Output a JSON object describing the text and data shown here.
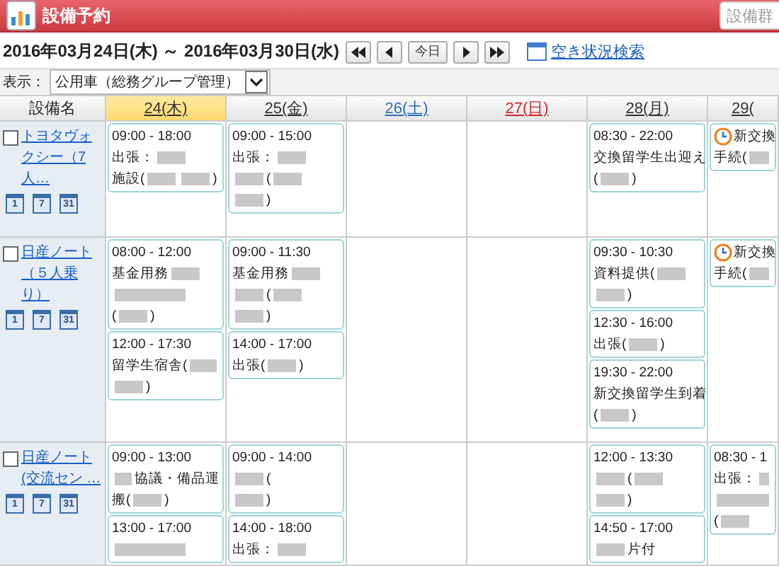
{
  "app": {
    "title": "設備予約",
    "top_button": "設備群"
  },
  "range": "2016年03月24日(木) ～ 2016年03月30日(水)",
  "nav": [
    {
      "kind": "first"
    },
    {
      "kind": "prev"
    },
    {
      "kind": "today",
      "label": "今日"
    },
    {
      "kind": "next"
    },
    {
      "kind": "last"
    }
  ],
  "search_link": "空き状況検索",
  "display": {
    "label": "表示：",
    "value": "公用車（総務グループ管理）"
  },
  "table": {
    "name_header": "設備名",
    "days": [
      {
        "label": "24(木)",
        "kind": "weekday",
        "selected": true
      },
      {
        "label": "25(金)",
        "kind": "weekday",
        "selected": false
      },
      {
        "label": "26(土)",
        "kind": "saturday",
        "selected": false
      },
      {
        "label": "27(日)",
        "kind": "sunday",
        "selected": false
      },
      {
        "label": "28(月)",
        "kind": "weekday",
        "selected": false
      },
      {
        "label": "29(",
        "kind": "weekday",
        "selected": false
      }
    ],
    "rows": [
      {
        "name": "トヨタヴォクシー（7人…",
        "checked": false,
        "views": [
          "1",
          "7",
          "31"
        ],
        "cells": [
          [
            {
              "time": "09:00 - 18:00",
              "lines": [
                [
                  "出張：",
                  {
                    "kind": "blur"
                  }
                ],
                [
                  "施設(",
                  {
                    "kind": "blur"
                  },
                  {
                    "kind": "blur"
                  },
                  ")"
                ]
              ]
            }
          ],
          [
            {
              "time": "09:00 - 15:00",
              "lines": [
                [
                  "出張：",
                  {
                    "kind": "blur"
                  }
                ],
                [
                  {
                    "kind": "blur"
                  },
                  "(",
                  {
                    "kind": "blur"
                  }
                ],
                [
                  {
                    "kind": "blur"
                  },
                  ")"
                ]
              ]
            }
          ],
          [],
          [],
          [
            {
              "time": "08:30 - 22:00",
              "lines": [
                [
                  "交換留学生出迎え"
                ],
                [
                  "(",
                  {
                    "kind": "blur"
                  },
                  ")"
                ]
              ]
            }
          ],
          [
            {
              "kind": "reminder",
              "lines": [
                [
                  "新交換"
                ],
                [
                  "手続(",
                  {
                    "kind": "blur"
                  }
                ]
              ]
            }
          ]
        ]
      },
      {
        "name": "日産ノート（５人乗り）",
        "checked": false,
        "views": [
          "1",
          "7",
          "31"
        ],
        "cells": [
          [
            {
              "time": "08:00 - 12:00",
              "lines": [
                [
                  "基金用務",
                  {
                    "kind": "blur"
                  }
                ],
                [
                  {
                    "kind": "blur"
                  }
                ],
                [
                  "(",
                  {
                    "kind": "blur"
                  },
                  ")"
                ]
              ]
            },
            {
              "time": "12:00 - 17:30",
              "lines": [
                [
                  "留学生宿舎(",
                  {
                    "kind": "blur"
                  }
                ],
                [
                  {
                    "kind": "blur"
                  },
                  ")"
                ]
              ]
            }
          ],
          [
            {
              "time": "09:00 - 11:30",
              "lines": [
                [
                  "基金用務",
                  {
                    "kind": "blur"
                  }
                ],
                [
                  {
                    "kind": "blur"
                  },
                  "(",
                  {
                    "kind": "blur"
                  }
                ],
                [
                  {
                    "kind": "blur"
                  },
                  ")"
                ]
              ]
            },
            {
              "time": "14:00 - 17:00",
              "lines": [
                [
                  "出張(",
                  {
                    "kind": "blur"
                  },
                  ")"
                ]
              ]
            }
          ],
          [],
          [],
          [
            {
              "time": "09:30 - 10:30",
              "lines": [
                [
                  "資料提供(",
                  {
                    "kind": "blur"
                  }
                ],
                [
                  {
                    "kind": "blur"
                  },
                  ")"
                ]
              ]
            },
            {
              "time": "12:30 - 16:00",
              "lines": [
                [
                  "出張(",
                  {
                    "kind": "blur"
                  },
                  ")"
                ]
              ]
            },
            {
              "time": "19:30 - 22:00",
              "lines": [
                [
                  "新交換留学生到着"
                ],
                [
                  "(",
                  {
                    "kind": "blur"
                  },
                  ")"
                ]
              ]
            }
          ],
          [
            {
              "kind": "reminder",
              "lines": [
                [
                  "新交換"
                ],
                [
                  "手続(",
                  {
                    "kind": "blur"
                  }
                ]
              ]
            }
          ]
        ]
      },
      {
        "name": "日産ノート(交流セン …",
        "checked": false,
        "views": [
          "1",
          "7",
          "31"
        ],
        "cells": [
          [
            {
              "time": "09:00 - 13:00",
              "lines": [
                [
                  {
                    "kind": "blur"
                  },
                  "協議・備品運"
                ],
                [
                  "搬(",
                  {
                    "kind": "blur"
                  },
                  ")"
                ]
              ]
            },
            {
              "time": "13:00 - 17:00",
              "lines": [
                [
                  {
                    "kind": "blur"
                  }
                ]
              ]
            }
          ],
          [
            {
              "time": "09:00 - 14:00",
              "lines": [
                [
                  {
                    "kind": "blur"
                  },
                  "("
                ],
                [
                  {
                    "kind": "blur"
                  },
                  ")"
                ]
              ]
            },
            {
              "time": "14:00 - 18:00",
              "lines": [
                [
                  "出張：",
                  {
                    "kind": "blur"
                  }
                ]
              ]
            }
          ],
          [],
          [],
          [
            {
              "time": "12:00 - 13:30",
              "lines": [
                [
                  {
                    "kind": "blur"
                  },
                  "(",
                  {
                    "kind": "blur"
                  }
                ],
                [
                  {
                    "kind": "blur"
                  },
                  ")"
                ]
              ]
            },
            {
              "time": "14:50 - 17:00",
              "lines": [
                [
                  {
                    "kind": "blur"
                  },
                  "片付"
                ]
              ]
            }
          ],
          [
            {
              "time": "08:30 - 1",
              "lines": [
                [
                  "出張：",
                  {
                    "kind": "blur"
                  }
                ],
                [
                  {
                    "kind": "blur"
                  }
                ],
                [
                  "(",
                  {
                    "kind": "blur"
                  }
                ]
              ]
            }
          ]
        ]
      }
    ]
  }
}
